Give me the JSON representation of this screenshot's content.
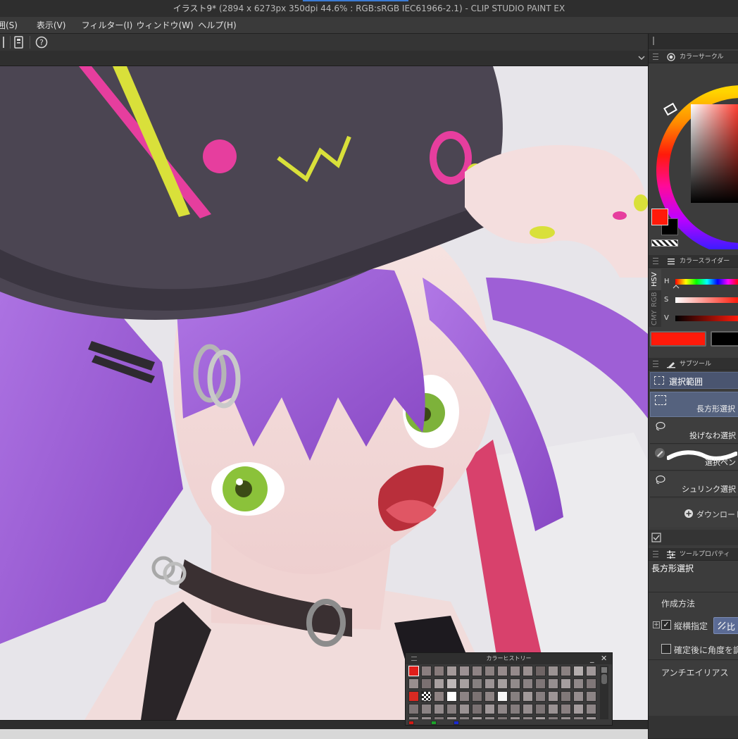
{
  "window": {
    "title": "イラスト9*",
    "subtitle": "(2894 x 6273px 350dpi 44.6% : RGB:sRGB IEC61966-2.1)  - CLIP STUDIO PAINT EX"
  },
  "menu": [
    "囲(S)",
    "表示(V)",
    "フィルター(I)",
    "ウィンドウ(W)",
    "ヘルプ(H)"
  ],
  "color_circle": {
    "title": "カラーサークル",
    "main_color": "#ff1a0a",
    "sub_color": "#000000"
  },
  "color_slider": {
    "title": "カラースライダー",
    "mode_tabs": [
      "HSV",
      "RGB",
      "CMY"
    ],
    "channels": [
      "H",
      "S",
      "V"
    ]
  },
  "subtool": {
    "title": "サブツール",
    "group_label": "選択範囲",
    "items": [
      {
        "label": "長方形選択",
        "selected": true,
        "icon": "rect-select-icon"
      },
      {
        "label": "投げなわ選択",
        "selected": false,
        "icon": "lasso-icon"
      },
      {
        "label": "選択ペン",
        "selected": false,
        "icon": "select-pen-icon"
      },
      {
        "label": "シュリンク選択",
        "selected": false,
        "icon": "shrink-select-icon"
      }
    ],
    "download_label": "ダウンロード"
  },
  "tool_property": {
    "title": "ツールプロパティ",
    "tool_name": "長方形選択",
    "creation_method_label": "作成方法",
    "aspect_label": "縦横指定",
    "aspect_checked": true,
    "ratio_label": "比",
    "angle_label": "確定後に角度を調",
    "angle_checked": false,
    "antialias_label": "アンチエイリアス"
  },
  "color_history": {
    "title": "カラーヒストリー",
    "swatches": [
      "#e01e1a",
      "#8a7e7f",
      "#877b7b",
      "#a49a9a",
      "#9c9193",
      "#8e8384",
      "#8b8181",
      "#968b8c",
      "#958a8b",
      "#9a9090",
      "#6f6565",
      "#9b9393",
      "#8a8181",
      "#b4aeae",
      "#a09899",
      "#998e8e",
      "#7b7071",
      "#a8a0a0",
      "#bfb9b9",
      "#a7a0a0",
      "#868080",
      "#9c9495",
      "#a6a0a0",
      "#928b8b",
      "#8a8283",
      "#7f7677",
      "#968f90",
      "#a59e9f",
      "#908889",
      "#807778",
      "#d82a22",
      "#checker",
      "#8f8484",
      "#ffffff",
      "#8c8384",
      "#7b7272",
      "#8e8585",
      "#f6f6f6",
      "#878080",
      "#a19a9a",
      "#877f80",
      "#9d9596",
      "#817979",
      "#958d8e",
      "#8c8485",
      "#7e7576",
      "#8b8384",
      "#938b8c",
      "#867e7f",
      "#9a9293",
      "#7a7172",
      "#a09899",
      "#8f8788",
      "#847c7d",
      "#958d8e",
      "#7d7576",
      "#9a9293",
      "#897f80",
      "#a49c9d",
      "#8d8586",
      "#8a8283",
      "#968e8f",
      "#7f7778",
      "#9e9697",
      "#877f80",
      "#a39b9c",
      "#918a8b",
      "#7c7475",
      "#999192",
      "#8e8687",
      "#a69e9f",
      "#837b7c",
      "#978f90",
      "#8b8384",
      "#a19a9b"
    ],
    "bottom_swatches": [
      "#d01a14",
      "#1ca22a",
      "#1a2ad0"
    ]
  }
}
